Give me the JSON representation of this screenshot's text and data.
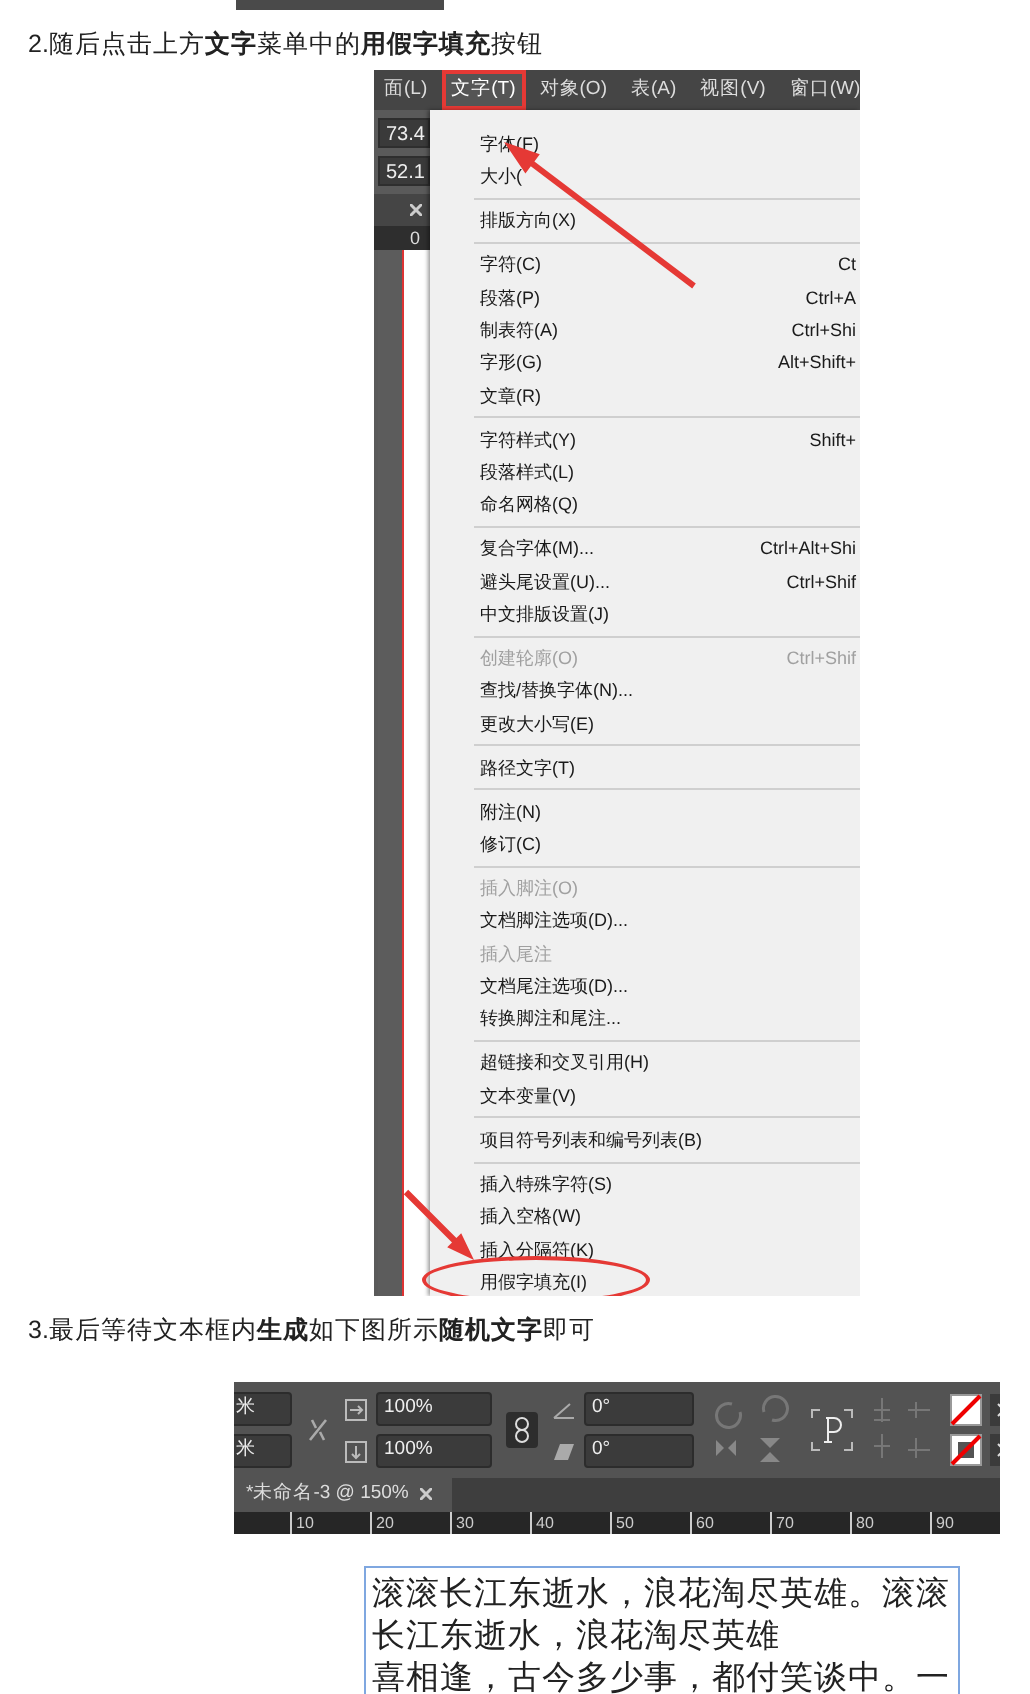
{
  "step_2": {
    "text": "2.随后点击上方**文字**菜单中的**用假字填充**按钮"
  },
  "menu_screenshot": {
    "menubar": [
      {
        "label": "面(L)",
        "marked": false
      },
      {
        "label": "文字(T)",
        "marked": true
      },
      {
        "label": "对象(O)",
        "marked": false
      },
      {
        "label": "表(A)",
        "marked": false
      },
      {
        "label": "视图(V)",
        "marked": false
      },
      {
        "label": "窗口(W)",
        "marked": false
      }
    ],
    "side_fields": [
      "73.4",
      "52.1"
    ],
    "ruler_label": "0",
    "menu_groups": [
      [
        {
          "label": "字体(F)",
          "disabled": false,
          "marked": false
        },
        {
          "label": "大小(",
          "disabled": false,
          "marked": false
        }
      ],
      [
        {
          "label": "排版方向(X)",
          "disabled": false,
          "marked": false
        }
      ],
      [
        {
          "label": "字符(C)",
          "shortcut": "Ct",
          "disabled": false,
          "marked": false
        },
        {
          "label": "段落(P)",
          "shortcut": "Ctrl+A",
          "disabled": false,
          "marked": false
        },
        {
          "label": "制表符(A)",
          "shortcut": "Ctrl+Shi",
          "disabled": false,
          "marked": false
        },
        {
          "label": "字形(G)",
          "shortcut": "Alt+Shift+",
          "disabled": false,
          "marked": false
        },
        {
          "label": "文章(R)",
          "disabled": false,
          "marked": false
        }
      ],
      [
        {
          "label": "字符样式(Y)",
          "shortcut": "Shift+",
          "disabled": false,
          "marked": false
        },
        {
          "label": "段落样式(L)",
          "disabled": false,
          "marked": false
        },
        {
          "label": "命名网格(Q)",
          "disabled": false,
          "marked": false
        }
      ],
      [
        {
          "label": "复合字体(M)...",
          "shortcut": "Ctrl+Alt+Shi",
          "disabled": false,
          "marked": false
        },
        {
          "label": "避头尾设置(U)...",
          "shortcut": "Ctrl+Shif",
          "disabled": false,
          "marked": false
        },
        {
          "label": "中文排版设置(J)",
          "disabled": false,
          "marked": false
        }
      ],
      [
        {
          "label": "创建轮廓(O)",
          "shortcut": "Ctrl+Shif",
          "disabled": true,
          "marked": false
        },
        {
          "label": "查找/替换字体(N)...",
          "disabled": false,
          "marked": false
        },
        {
          "label": "更改大小写(E)",
          "disabled": false,
          "marked": false
        }
      ],
      [
        {
          "label": "路径文字(T)",
          "disabled": false,
          "marked": false
        }
      ],
      [
        {
          "label": "附注(N)",
          "disabled": false,
          "marked": false
        },
        {
          "label": "修订(C)",
          "disabled": false,
          "marked": false
        }
      ],
      [
        {
          "label": "插入脚注(O)",
          "disabled": true,
          "marked": false
        },
        {
          "label": "文档脚注选项(D)...",
          "disabled": false,
          "marked": false
        },
        {
          "label": "插入尾注",
          "disabled": true,
          "marked": false
        },
        {
          "label": "文档尾注选项(D)...",
          "disabled": false,
          "marked": false
        },
        {
          "label": "转换脚注和尾注...",
          "disabled": false,
          "marked": false
        }
      ],
      [
        {
          "label": "超链接和交叉引用(H)",
          "disabled": false,
          "marked": false
        },
        {
          "label": "文本变量(V)",
          "disabled": false,
          "marked": false
        }
      ],
      [
        {
          "label": "项目符号列表和编号列表(B)",
          "disabled": false,
          "marked": false
        }
      ],
      [
        {
          "label": "插入特殊字符(S)",
          "disabled": false,
          "marked": false
        },
        {
          "label": "插入空格(W)",
          "disabled": false,
          "marked": false
        },
        {
          "label": "插入分隔符(K)",
          "disabled": false,
          "marked": false
        },
        {
          "label": "用假字填充(I)",
          "disabled": false,
          "marked": true
        }
      ]
    ]
  },
  "step_3": {
    "text": "3.最后等待文本框内**生成**如下图所示**随机文字**即可"
  },
  "toolbar_screenshot": {
    "unit_fields": [
      "米",
      "米"
    ],
    "scale_fields": [
      "100%",
      "100%"
    ],
    "angle_fields": [
      "0°",
      "0°"
    ],
    "tab": {
      "title": "*未命名-3 @ 150%"
    },
    "ruler_labels": [
      "10",
      "20",
      "30",
      "40",
      "50",
      "60",
      "70",
      "80",
      "90"
    ],
    "text_lines": [
      "滚滚长江东逝水，浪花淘尽英雄。滚滚",
      "长江东逝水，浪花淘尽英雄",
      "喜相逢，古今多少事，都付笑谈中。一"
    ]
  }
}
